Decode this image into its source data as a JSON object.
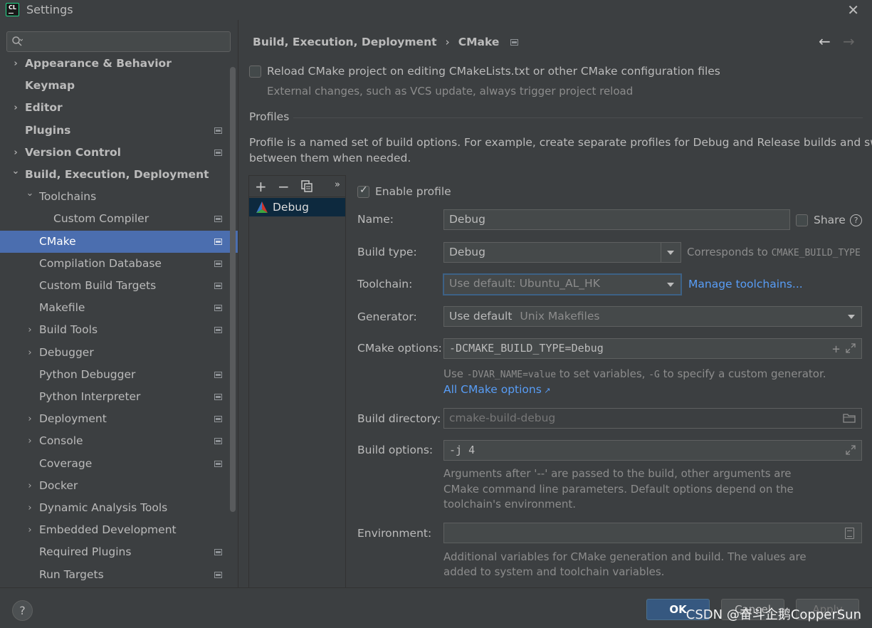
{
  "window": {
    "title": "Settings",
    "app_icon": "CL"
  },
  "sidebar": {
    "search": {
      "placeholder": "",
      "value": ""
    },
    "items": [
      {
        "label": "Appearance & Behavior",
        "expandable": true,
        "project": false
      },
      {
        "label": "Keymap",
        "expandable": false,
        "project": false
      },
      {
        "label": "Editor",
        "expandable": true,
        "project": false
      },
      {
        "label": "Plugins",
        "expandable": false,
        "project": true
      },
      {
        "label": "Version Control",
        "expandable": true,
        "project": true
      },
      {
        "label": "Build, Execution, Deployment",
        "expandable": true,
        "expanded": true,
        "project": false
      },
      {
        "label": "Toolchains",
        "expandable": true,
        "expanded": true,
        "project": false
      },
      {
        "label": "Custom Compiler",
        "expandable": false,
        "project": true
      },
      {
        "label": "CMake",
        "expandable": false,
        "project": true,
        "selected": true
      },
      {
        "label": "Compilation Database",
        "expandable": false,
        "project": true
      },
      {
        "label": "Custom Build Targets",
        "expandable": false,
        "project": true
      },
      {
        "label": "Makefile",
        "expandable": false,
        "project": true
      },
      {
        "label": "Build Tools",
        "expandable": true,
        "project": true
      },
      {
        "label": "Debugger",
        "expandable": true,
        "project": false
      },
      {
        "label": "Python Debugger",
        "expandable": false,
        "project": true
      },
      {
        "label": "Python Interpreter",
        "expandable": false,
        "project": true
      },
      {
        "label": "Deployment",
        "expandable": true,
        "project": true
      },
      {
        "label": "Console",
        "expandable": true,
        "project": true
      },
      {
        "label": "Coverage",
        "expandable": false,
        "project": true
      },
      {
        "label": "Docker",
        "expandable": true,
        "project": false
      },
      {
        "label": "Dynamic Analysis Tools",
        "expandable": true,
        "project": false
      },
      {
        "label": "Embedded Development",
        "expandable": true,
        "project": false
      },
      {
        "label": "Required Plugins",
        "expandable": false,
        "project": true
      },
      {
        "label": "Run Targets",
        "expandable": false,
        "project": true
      }
    ]
  },
  "breadcrumb": {
    "parent": "Build, Execution, Deployment",
    "separator": "›",
    "current": "CMake"
  },
  "reload": {
    "label": "Reload CMake project on editing CMakeLists.txt or other CMake configuration files",
    "checked": false,
    "hint": "External changes, such as VCS update, always trigger project reload"
  },
  "profiles": {
    "section_title": "Profiles",
    "description_line1": "Profile is a named set of build options. For example, create separate profiles for Debug and Release builds and switch",
    "description_line2": "between them when needed.",
    "list": [
      "Debug"
    ],
    "toolbar": {
      "add": "+",
      "remove": "−",
      "copy": "copy-icon",
      "more": "»"
    }
  },
  "form": {
    "enable_profile": {
      "label": "Enable profile",
      "checked": true
    },
    "name": {
      "label": "Name:",
      "value": "Debug"
    },
    "share": {
      "label": "Share",
      "checked": false
    },
    "build_type": {
      "label": "Build type:",
      "value": "Debug",
      "note_prefix": "Corresponds to ",
      "note_code": "CMAKE_BUILD_TYPE"
    },
    "toolchain": {
      "label": "Toolchain:",
      "value": "Use default: Ubuntu_AL_HK",
      "link": "Manage toolchains..."
    },
    "generator": {
      "label": "Generator:",
      "value": "Use default",
      "value_hint": "Unix Makefiles"
    },
    "cmake_options": {
      "label": "CMake options:",
      "value": "-DCMAKE_BUILD_TYPE=Debug",
      "hint_use": "Use ",
      "hint_code1": "-DVAR_NAME=value",
      "hint_mid": " to set variables, ",
      "hint_code2": "-G",
      "hint_end": " to specify a custom generator.",
      "link": "All CMake options"
    },
    "build_directory": {
      "label": "Build directory:",
      "placeholder": "cmake-build-debug"
    },
    "build_options": {
      "label": "Build options:",
      "value": "-j 4",
      "hint_line1": "Arguments after '--' are passed to the build, other arguments are",
      "hint_line2": "CMake command line parameters. Default options depend on the",
      "hint_line3": "toolchain's environment."
    },
    "environment": {
      "label": "Environment:",
      "value": "",
      "hint_line1": "Additional variables for CMake generation and build. The values are",
      "hint_line2": "added to system and toolchain variables."
    }
  },
  "footer": {
    "help": "?",
    "ok": "OK",
    "cancel": "Cancel",
    "apply": "Apply",
    "watermark": "CSDN @奋斗企鹅CopperSun"
  },
  "colors": {
    "selection": "#4b6eaf",
    "link": "#589df6",
    "background": "#3c3f41"
  }
}
